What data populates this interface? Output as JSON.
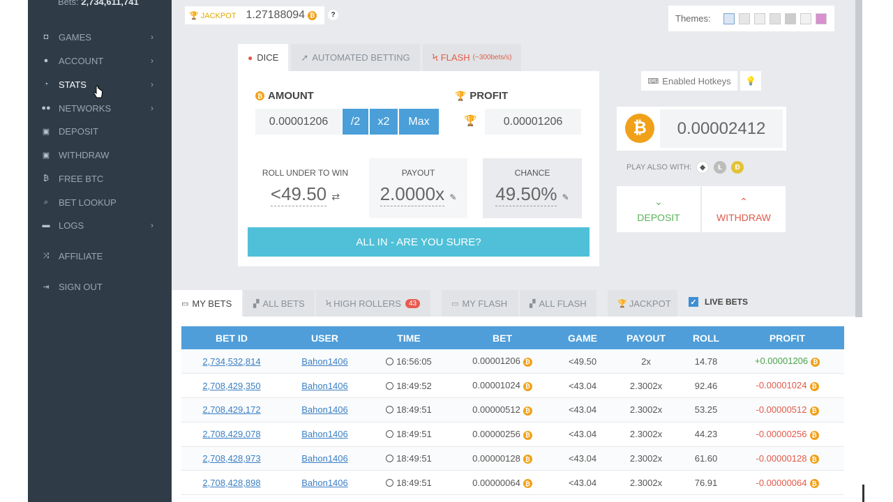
{
  "sidebar": {
    "bets_label": "Bets:",
    "bets_count": "2,734,611,741",
    "items": [
      {
        "label": "GAMES",
        "icon": "gamepad-icon"
      },
      {
        "label": "ACCOUNT",
        "icon": "user-icon"
      },
      {
        "label": "STATS",
        "icon": "pie-chart-icon"
      },
      {
        "label": "NETWORKS",
        "icon": "users-icon"
      },
      {
        "label": "DEPOSIT",
        "icon": "deposit-icon"
      },
      {
        "label": "WITHDRAW",
        "icon": "withdraw-icon"
      },
      {
        "label": "FREE BTC",
        "icon": "bitcoin-icon"
      },
      {
        "label": "BET LOOKUP",
        "icon": "search-icon"
      },
      {
        "label": "LOGS",
        "icon": "book-icon"
      },
      {
        "label": "AFFILIATE",
        "icon": "random-icon"
      },
      {
        "label": "SIGN OUT",
        "icon": "sign-out-icon"
      }
    ]
  },
  "jackpot": {
    "label": "JACKPOT",
    "value": "1.27188094",
    "help": "?"
  },
  "themes": {
    "label": "Themes:"
  },
  "game_tabs": {
    "dice": "DICE",
    "auto": "AUTOMATED BETTING",
    "flash": "FLASH",
    "flash_sub": "(~300bets/s)"
  },
  "bet": {
    "amount_label": "AMOUNT",
    "amount_value": "0.00001206",
    "half": "/2",
    "double": "x2",
    "max": "Max",
    "profit_label": "PROFIT",
    "profit_value": "0.00001206",
    "roll_label": "ROLL UNDER TO WIN",
    "roll_value": "<49.50",
    "payout_label": "PAYOUT",
    "payout_value": "2.0000x",
    "chance_label": "CHANCE",
    "chance_value": "49.50%",
    "allin": "ALL IN - ARE YOU SURE?"
  },
  "right": {
    "hotkeys": "Enabled Hotkeys",
    "balance": "0.00002412",
    "play_also": "PLAY ALSO WITH:",
    "deposit": "DEPOSIT",
    "withdraw": "WITHDRAW"
  },
  "bet_tabs": {
    "my_bets": "MY BETS",
    "all_bets": "ALL BETS",
    "high_rollers": "HIGH ROLLERS",
    "high_rollers_count": "43",
    "my_flash": "MY FLASH",
    "all_flash": "ALL FLASH",
    "jackpot": "JACKPOT",
    "live_bets": "LIVE BETS"
  },
  "table": {
    "headers": [
      "BET ID",
      "USER",
      "TIME",
      "BET",
      "GAME",
      "PAYOUT",
      "ROLL",
      "PROFIT"
    ],
    "rows": [
      {
        "id": "2,734,532,814",
        "user": "Bahon1406",
        "time": "16:56:05",
        "bet": "0.00001206",
        "game": "<49.50",
        "payout": "2x",
        "roll": "14.78",
        "profit": "+0.00001206",
        "win": true
      },
      {
        "id": "2,708,429,350",
        "user": "Bahon1406",
        "time": "18:49:52",
        "bet": "0.00001024",
        "game": "<43.04",
        "payout": "2.3002x",
        "roll": "92.46",
        "profit": "-0.00001024",
        "win": false
      },
      {
        "id": "2,708,429,172",
        "user": "Bahon1406",
        "time": "18:49:51",
        "bet": "0.00000512",
        "game": "<43.04",
        "payout": "2.3002x",
        "roll": "53.25",
        "profit": "-0.00000512",
        "win": false
      },
      {
        "id": "2,708,429,078",
        "user": "Bahon1406",
        "time": "18:49:51",
        "bet": "0.00000256",
        "game": "<43.04",
        "payout": "2.3002x",
        "roll": "44.23",
        "profit": "-0.00000256",
        "win": false
      },
      {
        "id": "2,708,428,973",
        "user": "Bahon1406",
        "time": "18:49:51",
        "bet": "0.00000128",
        "game": "<43.04",
        "payout": "2.3002x",
        "roll": "61.60",
        "profit": "-0.00000128",
        "win": false
      },
      {
        "id": "2,708,428,898",
        "user": "Bahon1406",
        "time": "18:49:51",
        "bet": "0.00000064",
        "game": "<43.04",
        "payout": "2.3002x",
        "roll": "76.91",
        "profit": "-0.00000064",
        "win": false
      }
    ]
  },
  "colors": {
    "accent": "#4f9ed9",
    "bitcoin": "#f0a019",
    "win": "#4ba34b",
    "loss": "#e05a4a",
    "sidebar": "#2f3c48"
  }
}
